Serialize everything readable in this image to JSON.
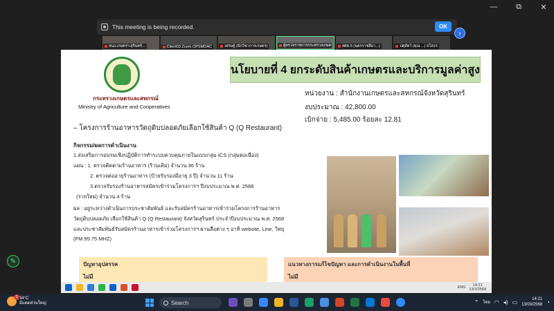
{
  "window": {
    "controls": [
      "—",
      "⧉",
      "✕"
    ]
  },
  "recording_banner": {
    "text": "This meeting is being recorded.",
    "ok_label": "OK"
  },
  "participants": [
    "สนง.เกษตรฯ.สุรินทร์...",
    "Client03 Zoom OPSMOAC",
    "เศรษฐ์ (นักวิชาการเกษตร)",
    "ผู้ตรวจราชการกระทรวงเกษตรฯ",
    "สศท.5 (นครราชสีมา...)",
    "ปศุสัตว์ (คุณ ...) ยโสธร"
  ],
  "slide": {
    "org_th": "กระทรวงเกษตรและสหกรณ์",
    "org_en": "Ministry of Agriculture and Cooperatives",
    "title": "นโยบายที่ 4 ยกระดับสินค้าเกษตรและบริการมูลค่าสูง",
    "agency": "หน่วยงาน : สำนักงานเกษตรและสหกรณ์จังหวัดสุรินทร์",
    "budget": "งบประมาณ : 42,800.00",
    "spent": "เบิกจ่าย : 5,485.00 ร้อยละ 12.81",
    "project": "–   โครงการร้านอาหารวัตถุดิบปลอดภัยเลือกใช้สินค้า Q (Q Restaurant)",
    "activities_heading": "กิจกรรม/ผลการดำเนินงาน",
    "lines": [
      "1.ส่งเสริมการอบรมเชิงปฏิบัติการทำระบบควบคุมภายในแบบกลุ่ม ICS (กลุ่มต่อเนื่อง)",
      "แผน :  1. ตรวจติดตามร้านอาหาร (ร้านเดิม) จำนวน 36 ร้าน",
      "2. ตรวจต่ออายุร้านอาหาร (ป้ายรับรองมีอายุ 3 ปี)  จำนวน 11 ร้าน",
      "3.ตรวจรับรองร้านอาหารสมัครเข้าร่วมโครงการฯ ปีงบประมาณ พ.ศ. 2568",
      "(รายใหม่) จำนวน 4 ร้าน",
      "ผล :  อยู่ระหว่างดำเนินการประชาสัมพันธ์ และรับสมัครร้านอาหารเข้าร่วมโครงการร้านอาหาร",
      "วัตถุดิบปลอดภัย เลือกใช้สินค้า Q (Q Restaurant) จังหวัดสุรินทร์  ประจำปีงบประมาณ พ.ศ. 2568",
      "และประชาสัมพันธ์รับสมัครร้านอาหารเข้าร่วมโครงการฯ ผ่านสื่อต่าง ๆ อาทิ website, Line, วิทยุ",
      "(FM 95.75 MHZ)"
    ],
    "problems_heading": "ปัญหาอุปสรรค",
    "problems_value": "ไม่มี",
    "solutions_heading": "แนวทางการแก้ไขปัญหา และการดำเนินงานในพื้นที่",
    "solutions_value": "ไม่มี"
  },
  "inner_taskbar": {
    "lang": "ENG",
    "time": "14:21",
    "date": "13/3/2568"
  },
  "taskbar": {
    "temperature": "34°C",
    "weather": "มีแดดส่วนใหญ่",
    "weather_badge": "1",
    "search_label": "Search",
    "lang": "ไทย",
    "time": "14:21",
    "date": "13/03/2568"
  }
}
